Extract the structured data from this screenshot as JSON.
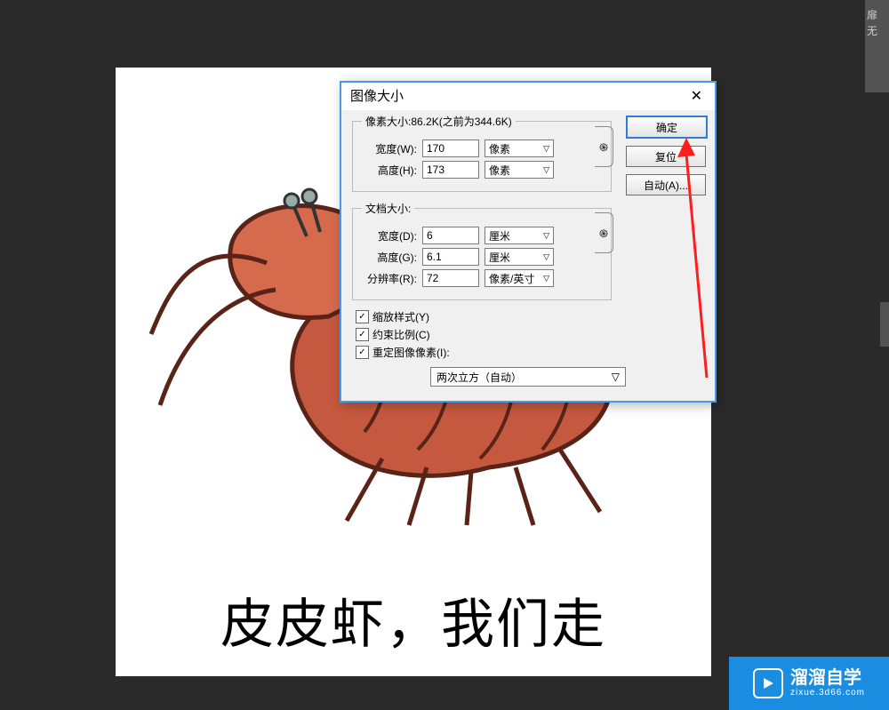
{
  "side_panel": {
    "line1": "扉",
    "line2": "无"
  },
  "canvas": {
    "meme_text": "皮皮虾，我们走"
  },
  "dialog": {
    "title": "图像大小",
    "pixel_legend": "像素大小:86.2K(之前为344.6K)",
    "pixel": {
      "width_label": "宽度(W):",
      "width_value": "170",
      "width_unit": "像素",
      "height_label": "高度(H):",
      "height_value": "173",
      "height_unit": "像素"
    },
    "doc_legend": "文档大小:",
    "doc": {
      "width_label": "宽度(D):",
      "width_value": "6",
      "width_unit": "厘米",
      "height_label": "高度(G):",
      "height_value": "6.1",
      "height_unit": "厘米",
      "res_label": "分辨率(R):",
      "res_value": "72",
      "res_unit": "像素/英寸"
    },
    "checks": {
      "scale_styles": "缩放样式(Y)",
      "constrain": "约束比例(C)",
      "resample": "重定图像像素(I):"
    },
    "resample_method": "两次立方（自动）",
    "buttons": {
      "ok": "确定",
      "reset": "复位",
      "auto": "自动(A)..."
    }
  },
  "watermark": {
    "brand": "溜溜自学",
    "url": "zixue.3d66.com"
  }
}
